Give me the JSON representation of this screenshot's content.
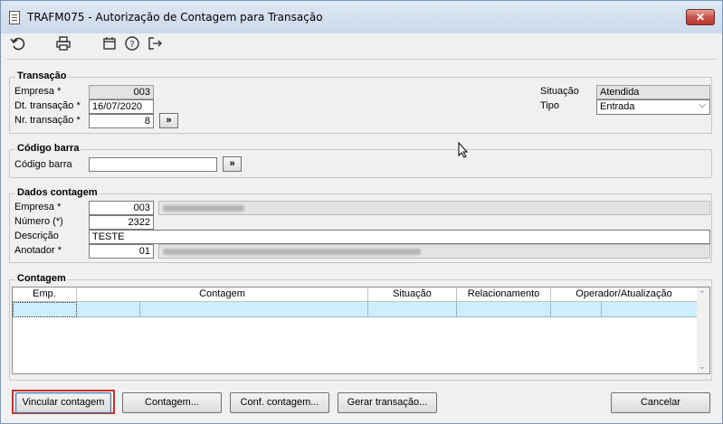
{
  "window": {
    "title": "TRAFM075 - Autorização de Contagem para Transação",
    "close_label": "✕"
  },
  "toolbar": {
    "icons": [
      "undo-icon",
      "print-icon",
      "calendar-icon",
      "help-icon",
      "exit-icon"
    ]
  },
  "transacao": {
    "legend": "Transação",
    "empresa_label": "Empresa *",
    "empresa_value": "003",
    "dt_label": "Dt. transação *",
    "dt_value": "16/07/2020",
    "nr_label": "Nr. transação *",
    "nr_value": "8",
    "situacao_label": "Situação",
    "situacao_value": "Atendida",
    "tipo_label": "Tipo",
    "tipo_value": "Entrada",
    "go_label": "»"
  },
  "codigo_barra": {
    "legend": "Código barra",
    "label": "Código barra",
    "value": "",
    "go_label": "»"
  },
  "dados_contagem": {
    "legend": "Dados contagem",
    "empresa_label": "Empresa *",
    "empresa_value": "003",
    "numero_label": "Número (*)",
    "numero_value": "2322",
    "descricao_label": "Descrição",
    "descricao_value": "TESTE",
    "anotador_label": "Anotador *",
    "anotador_value": "01"
  },
  "contagem": {
    "legend": "Contagem",
    "columns": [
      "Emp.",
      "Contagem",
      "Situação",
      "Relacionamento",
      "Operador/Atualização"
    ]
  },
  "buttons": {
    "vincular": "Vincular contagem",
    "contagem": "Contagem...",
    "conf_contagem": "Conf. contagem...",
    "gerar": "Gerar transação...",
    "cancelar": "Cancelar"
  },
  "colors": {
    "highlight": "#d42a2a",
    "grid_row": "#cdeffc"
  }
}
